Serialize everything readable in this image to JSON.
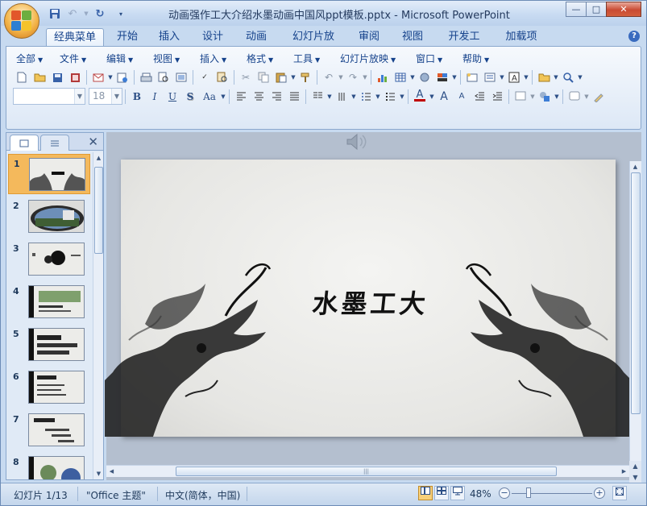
{
  "window": {
    "title": "动画强作工大介绍水墨动画中国风ppt模板.pptx - Microsoft PowerPoint",
    "minimize_label": "—",
    "maximize_label": "□",
    "close_label": "✕"
  },
  "ribbon_tabs": [
    "经典菜单",
    "开始",
    "插入",
    "设计",
    "动画",
    "幻灯片放映",
    "审阅",
    "视图",
    "开发工具",
    "加载项"
  ],
  "active_tab": "经典菜单",
  "help_label": "?",
  "classic_menu": [
    {
      "label": "全部"
    },
    {
      "label": "文件"
    },
    {
      "label": "编辑"
    },
    {
      "label": "视图"
    },
    {
      "label": "插入"
    },
    {
      "label": "格式"
    },
    {
      "label": "工具"
    },
    {
      "label": "幻灯片放映"
    },
    {
      "label": "窗口"
    },
    {
      "label": "帮助"
    }
  ],
  "format_bar": {
    "font_name": "",
    "font_size": "18",
    "bold": "B",
    "italic": "I",
    "underline": "U",
    "shadow": "S",
    "change_case": "Aa",
    "font_color_label": "A",
    "grow_font": "A",
    "shrink_font": "A"
  },
  "outline_pane": {
    "tab_slides_icon": "slides-tab-icon",
    "tab_outline_icon": "outline-tab-icon",
    "close_label": "✕",
    "slides": [
      {
        "number": "1",
        "selected": true
      },
      {
        "number": "2",
        "selected": false
      },
      {
        "number": "3",
        "selected": false
      },
      {
        "number": "4",
        "selected": false
      },
      {
        "number": "5",
        "selected": false
      },
      {
        "number": "6",
        "selected": false
      },
      {
        "number": "7",
        "selected": false
      },
      {
        "number": "8",
        "selected": false
      }
    ]
  },
  "slide": {
    "title": "水墨工大"
  },
  "status_bar": {
    "slide_info": "幻灯片 1/13",
    "theme": "\"Office 主题\"",
    "language": "中文(简体，中国)",
    "zoom": "48%",
    "zoom_level": 0.48
  },
  "colors": {
    "ribbon_bg": "#dde8f6",
    "accent_text": "#15428b",
    "selected_thumb": "#f4b95c",
    "close_button": "#c94b33"
  }
}
